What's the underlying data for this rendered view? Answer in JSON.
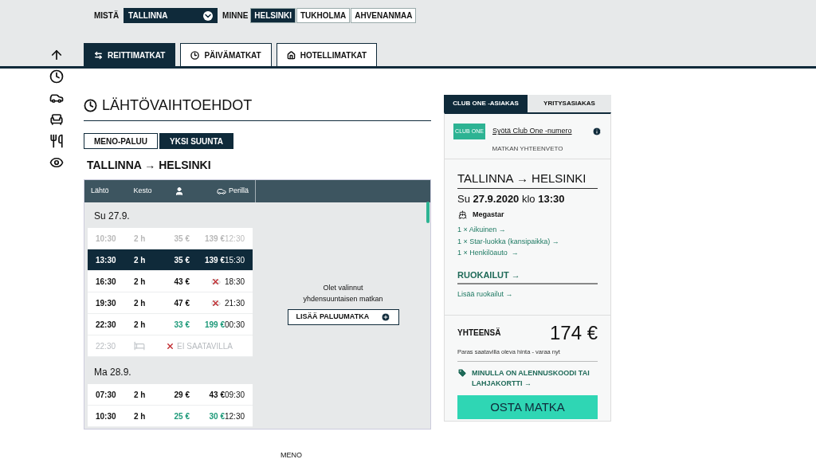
{
  "route_selector": {
    "from_label": "MISTÄ",
    "from_value": "TALLINNA",
    "to_label": "MINNE",
    "destinations": [
      {
        "label": "HELSINKI",
        "selected": true
      },
      {
        "label": "TUKHOLMA",
        "selected": false
      },
      {
        "label": "AHVENANMAA",
        "selected": false
      }
    ]
  },
  "tabs": [
    {
      "label": "REITTIMATKAT",
      "selected": true
    },
    {
      "label": "PÄIVÄMATKAT",
      "selected": false
    },
    {
      "label": "HOTELLIMATKAT",
      "selected": false
    }
  ],
  "section": {
    "title": "LÄHTÖVAIHTOEHDOT",
    "trip_types": [
      {
        "label": "MENO-PALUU",
        "selected": false
      },
      {
        "label": "YKSI SUUNTA",
        "selected": true
      }
    ],
    "route": "TALLINNA → HELSINKI"
  },
  "table": {
    "columns": [
      {
        "kind": "text",
        "label": "Lähtö"
      },
      {
        "kind": "text",
        "label": "Kesto"
      },
      {
        "kind": "person"
      },
      {
        "kind": "car"
      },
      {
        "kind": "text",
        "label": "Perillä"
      }
    ],
    "days": [
      {
        "date": "Su 27.9.",
        "rows": [
          {
            "kind": "trip",
            "departure": "10:30",
            "duration": "2 h",
            "passenger_price": "35 €",
            "car_price": "139 €",
            "car_available": true,
            "arrival": "12:30",
            "selected": false,
            "faded": true,
            "discount": false
          },
          {
            "kind": "trip",
            "departure": "13:30",
            "duration": "2 h",
            "passenger_price": "35 €",
            "car_price": "139 €",
            "car_available": true,
            "arrival": "15:30",
            "selected": true,
            "faded": false,
            "discount": false
          },
          {
            "kind": "trip",
            "departure": "16:30",
            "duration": "2 h",
            "passenger_price": "43 €",
            "car_available": false,
            "arrival": "18:30",
            "selected": false,
            "faded": false,
            "discount": false
          },
          {
            "kind": "trip",
            "departure": "19:30",
            "duration": "2 h",
            "passenger_price": "47 €",
            "car_available": false,
            "arrival": "21:30",
            "selected": false,
            "faded": false,
            "discount": false
          },
          {
            "kind": "trip",
            "departure": "22:30",
            "duration": "2 h",
            "passenger_price": "33 €",
            "car_price": "199 €",
            "car_available": true,
            "arrival": "00:30",
            "selected": false,
            "faded": false,
            "discount": true
          },
          {
            "kind": "unavailable",
            "departure": "22:30",
            "status": "EI SAATAVILLA"
          }
        ]
      },
      {
        "date": "Ma 28.9.",
        "rows": [
          {
            "kind": "trip",
            "departure": "07:30",
            "duration": "2 h",
            "passenger_price": "29 €",
            "car_price": "43 €",
            "car_available": true,
            "arrival": "09:30",
            "selected": false,
            "faded": false,
            "discount": false
          },
          {
            "kind": "trip",
            "departure": "10:30",
            "duration": "2 h",
            "passenger_price": "25 €",
            "car_price": "30 €",
            "car_available": true,
            "arrival": "12:30",
            "selected": false,
            "faded": false,
            "discount": true
          }
        ]
      }
    ]
  },
  "notice": {
    "text": "Olet valinnut yhdensuuntaisen matkan",
    "button": "LISÄÄ PALUUMATKA"
  },
  "summary": {
    "tabs": [
      {
        "label": "CLUB ONE -ASIAKAS",
        "selected": true
      },
      {
        "label": "YRITYSASIAKAS",
        "selected": false
      }
    ],
    "club_logo": "CLUB ONE",
    "club_link": "Syötä Club One -numero",
    "heading": "MATKAN YHTEENVETO",
    "route": "TALLINNA → HELSINKI",
    "date": "Su **27.9.2020** klo **13:30**",
    "ship": "Megastar",
    "items": [
      "1 × Aikuinen →",
      "1 × Star-luokka (kansipaikka) →",
      "1 × Henkilöauto  →"
    ],
    "meals_title": "RUOKAILUT →",
    "meals_link": "Lisää ruokailut →",
    "total_label": "YHTEENSÄ",
    "total": "174 €",
    "total_note": "Paras saatavilla oleva hinta - varaa nyt",
    "discount_link": "MINULLA ON ALENNUSKOODI TAI LAHJAKORTTI →",
    "buy_button": "OSTA MATKA"
  },
  "bottom_label": "MENO"
}
